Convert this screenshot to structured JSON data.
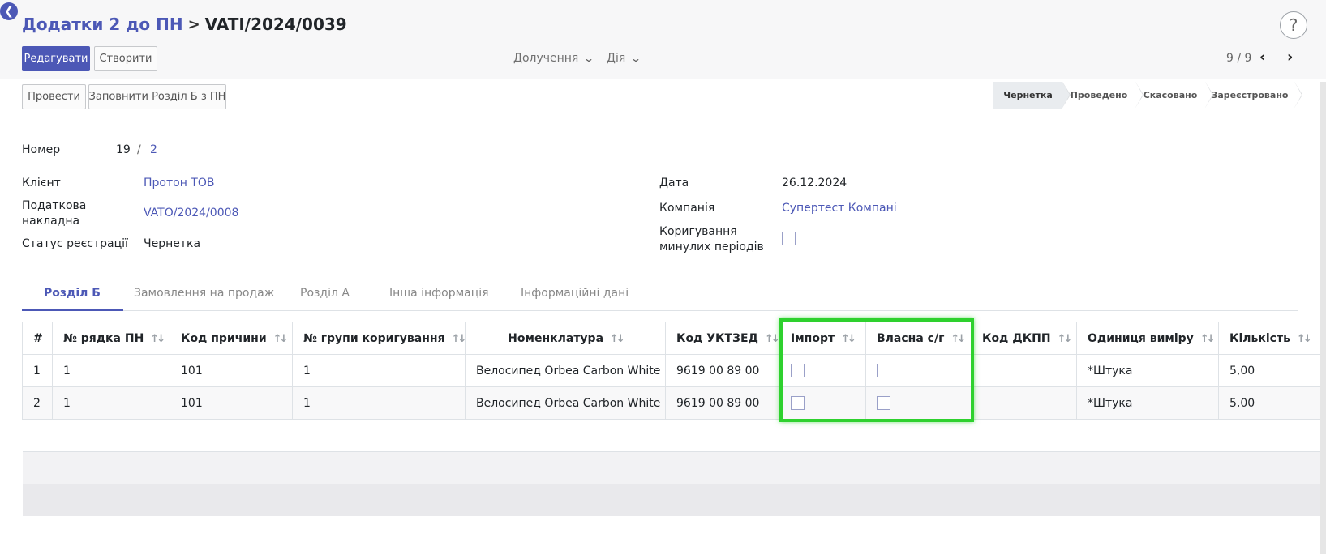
{
  "header": {
    "breadcrumb_parent": "Додатки 2 до ПН",
    "breadcrumb_sep": ">",
    "breadcrumb_current": "VATI/2024/0039",
    "help": "?"
  },
  "toolbar": {
    "edit_label": "Редагувати",
    "create_label": "Створити",
    "attachments_label": "Долучення",
    "action_label": "Дія",
    "pager": "9 / 9"
  },
  "actions": {
    "post_label": "Провести",
    "fill_label": "Заповнити Розділ Б з ПН"
  },
  "statusbar": [
    "Чернетка",
    "Проведено",
    "Скасовано",
    "Зареєстровано"
  ],
  "form": {
    "number_label": "Номер",
    "number_value": "19",
    "number_sep": "/",
    "number_sub": "2",
    "client_label": "Клієнт",
    "client_value": "Протон ТОВ",
    "tax_invoice_label_1": "Податкова",
    "tax_invoice_label_2": "накладна",
    "tax_invoice_value": "VATO/2024/0008",
    "reg_status_label": "Статус реєстрації",
    "reg_status_value": "Чернетка",
    "date_label": "Дата",
    "date_value": "26.12.2024",
    "company_label": "Компанія",
    "company_value": "Супертест Компані",
    "correction_label_1": "Коригування",
    "correction_label_2": "минулих періодів"
  },
  "tabs": [
    "Розділ Б",
    "Замовлення на продаж",
    "Розділ А",
    "Інша інформація",
    "Інформаційні дані"
  ],
  "table": {
    "columns": [
      "#",
      "№ рядка ПН",
      "Код причини",
      "№ групи коригування",
      "Номенклатура",
      "Код УКТЗЕД",
      "Імпорт",
      "Власна с/г",
      "Код ДКПП",
      "Одиниця виміру",
      "Кількість"
    ],
    "rows": [
      {
        "n": "1",
        "line": "1",
        "reason": "101",
        "group": "1",
        "product": "Велосипед Orbea Carbon White",
        "code": "9619 00 89 00",
        "dkpp": "",
        "uom": "*Штука",
        "qty": "5,00"
      },
      {
        "n": "2",
        "line": "1",
        "reason": "101",
        "group": "1",
        "product": "Велосипед Orbea Carbon White",
        "code": "9619 00 89 00",
        "dkpp": "",
        "uom": "*Штука",
        "qty": "5,00"
      }
    ]
  },
  "colors": {
    "accent": "#4c58b6",
    "highlight": "#2ed12e"
  }
}
